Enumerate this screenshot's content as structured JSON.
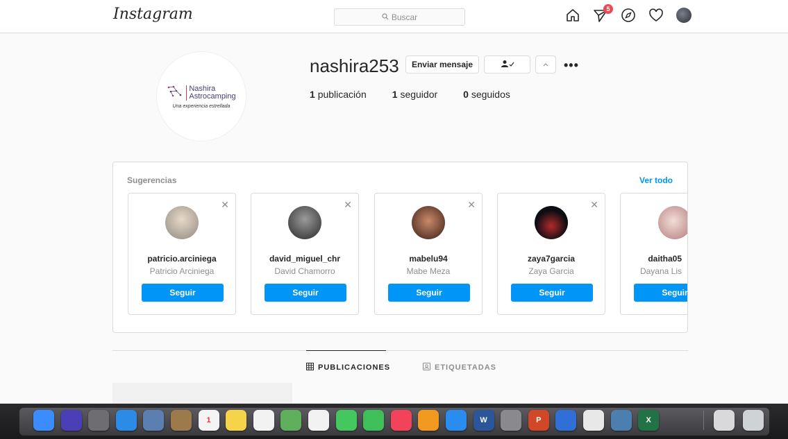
{
  "nav": {
    "logo": "Instagram",
    "search_placeholder": "Buscar",
    "notification_count": "5",
    "icons": [
      "home-icon",
      "direct-icon",
      "explore-icon",
      "heart-icon",
      "avatar"
    ]
  },
  "profile": {
    "username": "nashira253",
    "brand_line1": "Nashira",
    "brand_line2": "Astrocamping",
    "brand_tagline": "Una experiencia estrellada",
    "message_button": "Enviar mensaje",
    "stats": [
      {
        "count": "1",
        "label": "publicación"
      },
      {
        "count": "1",
        "label": "seguidor"
      },
      {
        "count": "0",
        "label": "seguidos"
      }
    ]
  },
  "suggestions": {
    "title": "Sugerencias",
    "see_all": "Ver todo",
    "follow_label": "Seguir",
    "cards": [
      {
        "username": "patricio.arciniega",
        "name": "Patricio Arciniega",
        "avatar_color": "#c9c3b8"
      },
      {
        "username": "david_miguel_chr",
        "name": "David Chamorro",
        "avatar_color": "#4a4a4a"
      },
      {
        "username": "mabelu94",
        "name": "Mabe Meza",
        "avatar_color": "#6b3a2a"
      },
      {
        "username": "zaya7garcia",
        "name": "Zaya Garcia",
        "avatar_color": "#1f1f2a"
      },
      {
        "username": "daitha05",
        "name": "Dayana Lis",
        "avatar_color": "#d8b3b0"
      }
    ]
  },
  "tabs": [
    {
      "label": "PUBLICACIONES",
      "active": true
    },
    {
      "label": "ETIQUETADAS",
      "active": false
    }
  ],
  "dock": {
    "apps": [
      {
        "name": "finder",
        "color": "#3b8cff"
      },
      {
        "name": "siri",
        "color": "#4b3fb8"
      },
      {
        "name": "launchpad",
        "color": "#6d6d72"
      },
      {
        "name": "safari",
        "color": "#2b8be6"
      },
      {
        "name": "preview",
        "color": "#5b7fb0"
      },
      {
        "name": "contacts",
        "color": "#9c7a4c"
      },
      {
        "name": "calendar",
        "color": "#f4f4f4",
        "text": "1"
      },
      {
        "name": "notes",
        "color": "#f5d44a"
      },
      {
        "name": "reminders",
        "color": "#f2f2f2"
      },
      {
        "name": "maps",
        "color": "#5fae5c"
      },
      {
        "name": "photos",
        "color": "#f2f2f2"
      },
      {
        "name": "messages",
        "color": "#45c760"
      },
      {
        "name": "facetime",
        "color": "#3fbf5a"
      },
      {
        "name": "music",
        "color": "#f3435b"
      },
      {
        "name": "books",
        "color": "#f29a1f"
      },
      {
        "name": "app-store",
        "color": "#2b8cf0"
      },
      {
        "name": "word",
        "color": "#2b579a",
        "text": "W"
      },
      {
        "name": "system-preferences",
        "color": "#8a8a8e"
      },
      {
        "name": "powerpoint",
        "color": "#d24726",
        "text": "P"
      },
      {
        "name": "keynote",
        "color": "#2f6fd6"
      },
      {
        "name": "chrome",
        "color": "#e8e8e8"
      },
      {
        "name": "network",
        "color": "#4a7fb0"
      },
      {
        "name": "excel",
        "color": "#217346",
        "text": "X"
      }
    ],
    "right": [
      {
        "name": "downloads",
        "color": "#d9d9dc"
      },
      {
        "name": "trash",
        "color": "#cfd3d6"
      }
    ]
  }
}
